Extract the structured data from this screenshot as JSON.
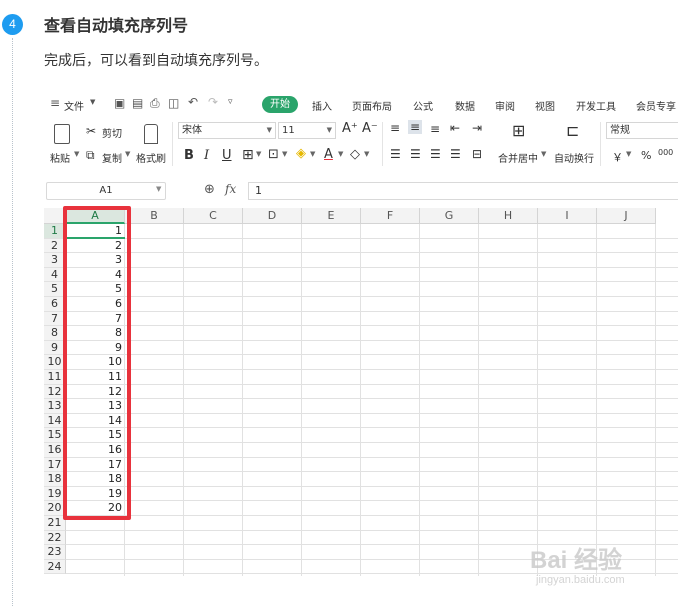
{
  "step": {
    "number": "4",
    "title": "查看自动填充序列号",
    "description": "完成后，可以看到自动填充序列号。"
  },
  "menu": {
    "file": "文件",
    "tabs": [
      "开始",
      "插入",
      "页面布局",
      "公式",
      "数据",
      "审阅",
      "视图",
      "开发工具",
      "会员专享"
    ],
    "active_tab": "开始"
  },
  "ribbon": {
    "paste": "粘贴",
    "cut": "剪切",
    "copy": "复制",
    "format_painter": "格式刷",
    "font_name": "宋体",
    "font_size": "11",
    "merge_center": "合并居中",
    "wrap_text": "自动换行",
    "number_format": "常规",
    "currency": "￥",
    "percent": "%",
    "thousands": "000"
  },
  "formula_bar": {
    "cell_ref": "A1",
    "fx": "fx",
    "value": "1"
  },
  "grid": {
    "columns": [
      "A",
      "B",
      "C",
      "D",
      "E",
      "F",
      "G",
      "H",
      "I",
      "J"
    ],
    "rows": [
      "1",
      "2",
      "3",
      "4",
      "5",
      "6",
      "7",
      "8",
      "9",
      "10",
      "11",
      "12",
      "13",
      "14",
      "15",
      "16",
      "17",
      "18",
      "19",
      "20",
      "21",
      "22",
      "23",
      "24"
    ],
    "column_a_values": [
      "1",
      "2",
      "3",
      "4",
      "5",
      "6",
      "7",
      "8",
      "9",
      "10",
      "11",
      "12",
      "13",
      "14",
      "15",
      "16",
      "17",
      "18",
      "19",
      "20"
    ]
  },
  "watermark": {
    "brand": "Bai 经验",
    "url": "jingyan.baidu.com"
  },
  "colors": {
    "accent_green": "#2aa46b",
    "highlight_red": "#e8323c",
    "step_blue": "#1e9cf0"
  }
}
